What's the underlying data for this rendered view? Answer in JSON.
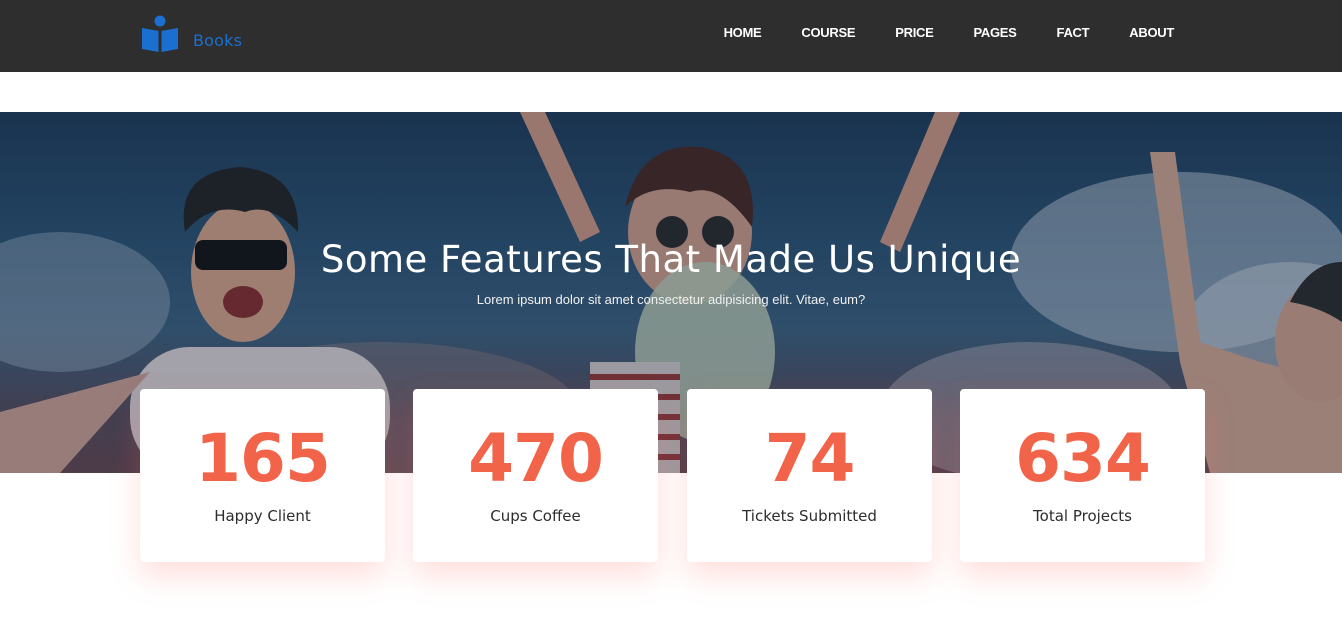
{
  "brand": {
    "name": "Books",
    "icon": "reader-book-icon",
    "color": "#1a6fd0"
  },
  "nav": {
    "items": [
      {
        "label": "HOME"
      },
      {
        "label": "COURSE"
      },
      {
        "label": "PRICE"
      },
      {
        "label": "PAGES"
      },
      {
        "label": "FACT"
      },
      {
        "label": "ABOUT"
      }
    ]
  },
  "hero": {
    "title": "Some Features That Made Us Unique",
    "subtitle": "Lorem ipsum dolor sit amet consectetur adipisicing elit. Vitae, eum?"
  },
  "stats": [
    {
      "value": "165",
      "label": "Happy Client"
    },
    {
      "value": "470",
      "label": "Cups Coffee"
    },
    {
      "value": "74",
      "label": "Tickets Submitted"
    },
    {
      "value": "634",
      "label": "Total Projects"
    }
  ],
  "colors": {
    "navbar_bg": "#2e2e2e",
    "accent": "#f26449",
    "card_bg": "#ffffff"
  }
}
